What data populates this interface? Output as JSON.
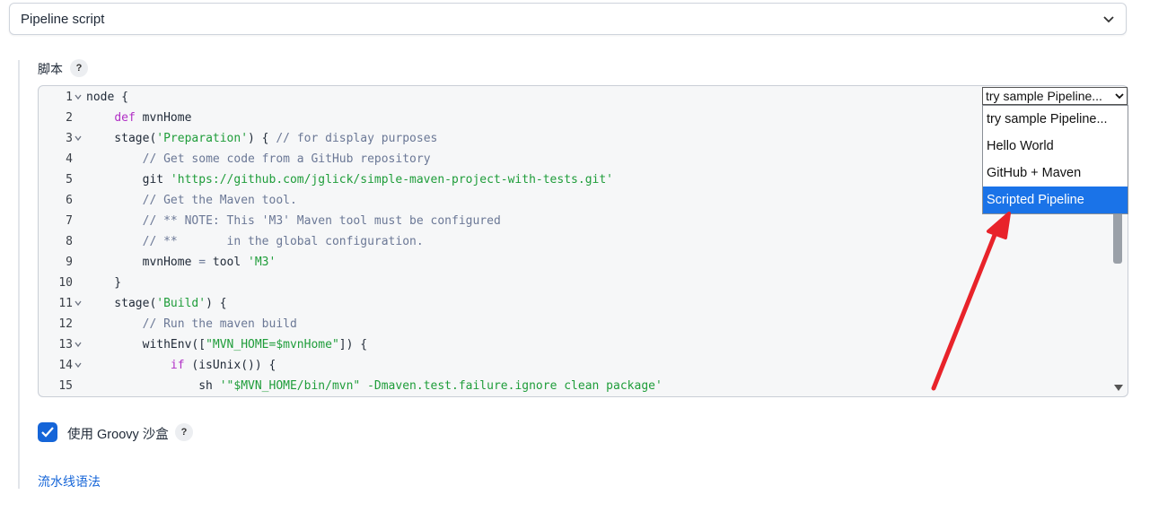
{
  "definition_select": {
    "value": "Pipeline script"
  },
  "script_section": {
    "label": "脚本",
    "help": "?"
  },
  "editor": {
    "lines": [
      {
        "n": "1",
        "fold": true,
        "html": "node {"
      },
      {
        "n": "2",
        "fold": false,
        "html": "    <span class=\"kw\">def</span> mvnHome"
      },
      {
        "n": "3",
        "fold": true,
        "html": "    stage(<span class=\"str\">'Preparation'</span>) { <span class=\"cm\">// for display purposes</span>"
      },
      {
        "n": "4",
        "fold": false,
        "html": "        <span class=\"cm\">// Get some code from a GitHub repository</span>"
      },
      {
        "n": "5",
        "fold": false,
        "html": "        git <span class=\"str\">'https://github.com/jglick/simple-maven-project-with-tests.git'</span>"
      },
      {
        "n": "6",
        "fold": false,
        "html": "        <span class=\"cm\">// Get the Maven tool.</span>"
      },
      {
        "n": "7",
        "fold": false,
        "html": "        <span class=\"cm\">// ** NOTE: This 'M3' Maven tool must be configured</span>"
      },
      {
        "n": "8",
        "fold": false,
        "html": "        <span class=\"cm\">// **       in the global configuration.</span>"
      },
      {
        "n": "9",
        "fold": false,
        "html": "        mvnHome <span class=\"cm\">=</span> tool <span class=\"str\">'M3'</span>"
      },
      {
        "n": "10",
        "fold": false,
        "html": "    }"
      },
      {
        "n": "11",
        "fold": true,
        "html": "    stage(<span class=\"str\">'Build'</span>) {"
      },
      {
        "n": "12",
        "fold": false,
        "html": "        <span class=\"cm\">// Run the maven build</span>"
      },
      {
        "n": "13",
        "fold": true,
        "html": "        withEnv([<span class=\"str\">\"MVN_HOME=$mvnHome\"</span>]) {"
      },
      {
        "n": "14",
        "fold": true,
        "html": "            <span class=\"kw\">if</span> (isUnix()) {"
      },
      {
        "n": "15",
        "fold": false,
        "html": "                sh <span class=\"str\">'\"$MVN_HOME/bin/mvn\" -Dmaven.test.failure.ignore clean package'</span>"
      }
    ]
  },
  "sample_select": {
    "value": "try sample Pipeline...",
    "options": [
      "try sample Pipeline...",
      "Hello World",
      "GitHub + Maven",
      "Scripted Pipeline"
    ],
    "selected_index": 3
  },
  "groovy_sandbox": {
    "label": "使用 Groovy 沙盒",
    "help": "?",
    "checked": true
  },
  "syntax_link": {
    "label": "流水线语法"
  },
  "colors": {
    "accent": "#1565d8",
    "selected_option": "#1a73e8",
    "arrow": "#e8232a"
  }
}
